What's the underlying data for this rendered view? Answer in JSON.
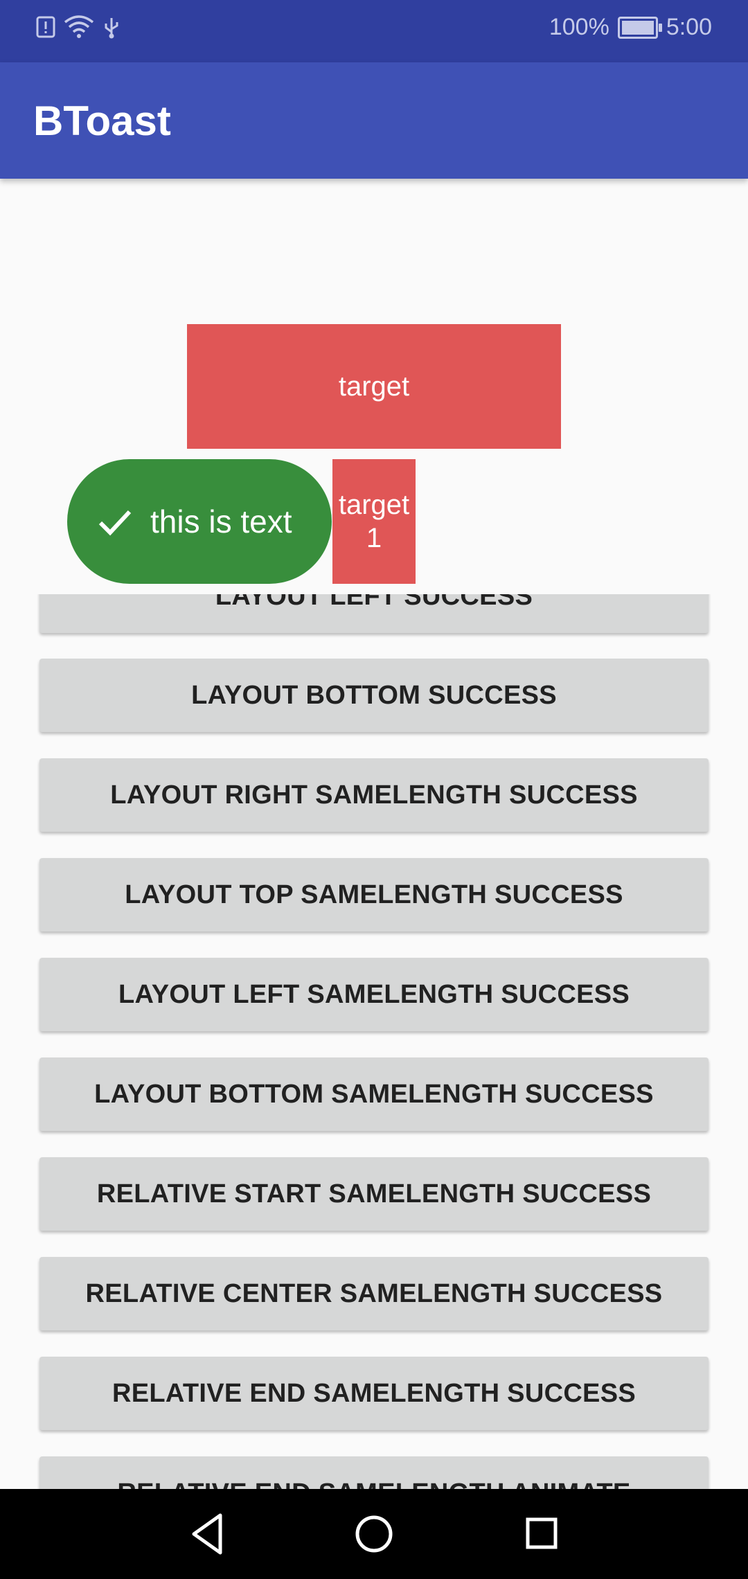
{
  "status": {
    "battery_text": "100%",
    "time": "5:00"
  },
  "app": {
    "title": "BToast"
  },
  "targets": {
    "target": "target",
    "target1_line1": "target",
    "target1_line2": "1"
  },
  "toast": {
    "text": "this is text",
    "color": "#388e3c",
    "icon": "check-icon"
  },
  "buttons": [
    "LAYOUT LEFT SUCCESS",
    "LAYOUT BOTTOM SUCCESS",
    "LAYOUT RIGHT SAMELENGTH SUCCESS",
    "LAYOUT TOP SAMELENGTH SUCCESS",
    "LAYOUT LEFT SAMELENGTH SUCCESS",
    "LAYOUT BOTTOM SAMELENGTH SUCCESS",
    "RELATIVE START SAMELENGTH SUCCESS",
    "RELATIVE CENTER SAMELENGTH SUCCESS",
    "RELATIVE END SAMELENGTH SUCCESS",
    "RELATIVE END SAMELENGTH ANIMATE"
  ],
  "colors": {
    "status_bar": "#303f9f",
    "app_bar": "#3f51b5",
    "target": "#e05656"
  }
}
